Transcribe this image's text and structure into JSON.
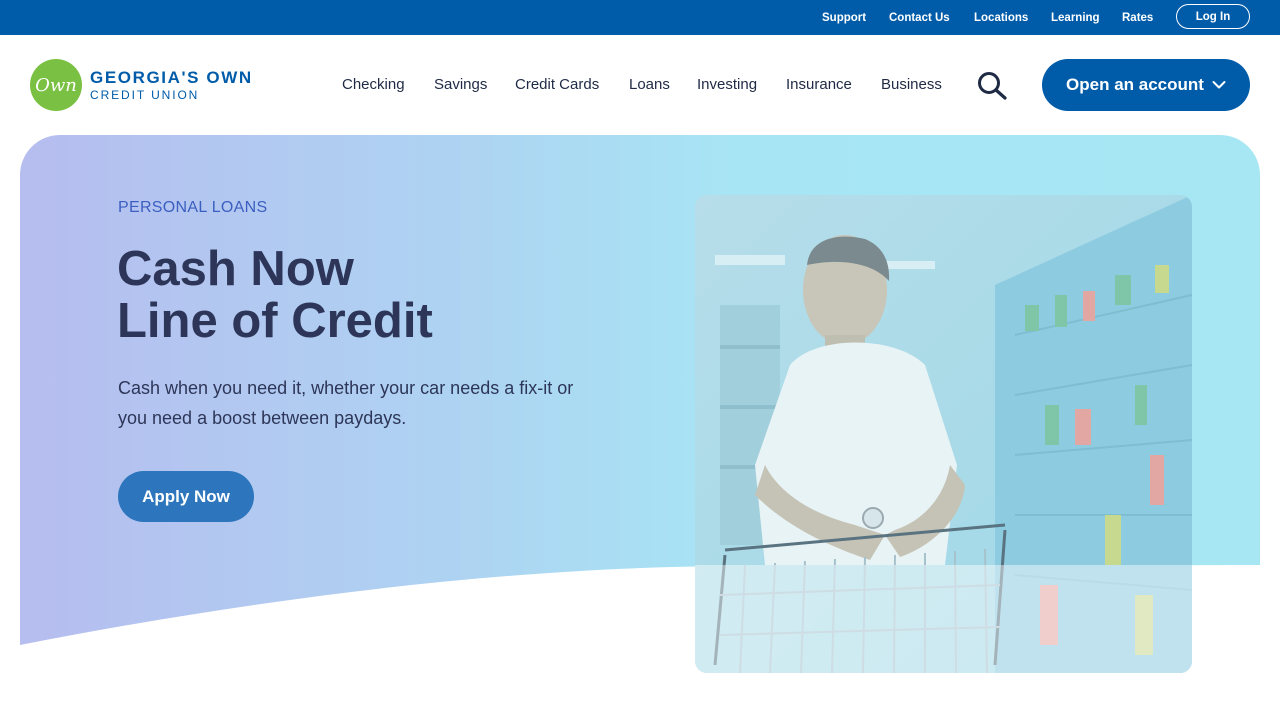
{
  "utility_nav": {
    "links": [
      "Support",
      "Contact Us",
      "Locations",
      "Learning",
      "Rates"
    ],
    "login_label": "Log In"
  },
  "header": {
    "logo": {
      "mark": "Own",
      "line1": "GEORGIA'S OWN",
      "line2": "CREDIT UNION"
    },
    "nav": [
      "Checking",
      "Savings",
      "Credit Cards",
      "Loans",
      "Investing",
      "Insurance",
      "Business"
    ],
    "search_icon": "search-icon",
    "open_account_label": "Open an account",
    "open_account_icon": "chevron-down-icon"
  },
  "hero": {
    "eyebrow": "PERSONAL LOANS",
    "title_line1": "Cash Now",
    "title_line2": "Line of Credit",
    "subtitle": "Cash when you need it, whether your car needs a fix-it or you need a boost between paydays.",
    "cta_label": "Apply Now"
  },
  "colors": {
    "brand_blue": "#005ca9",
    "brand_green": "#7ac143",
    "button_blue": "#2d76bd",
    "heading": "#2d3658",
    "eyebrow": "#3b5fc0"
  }
}
